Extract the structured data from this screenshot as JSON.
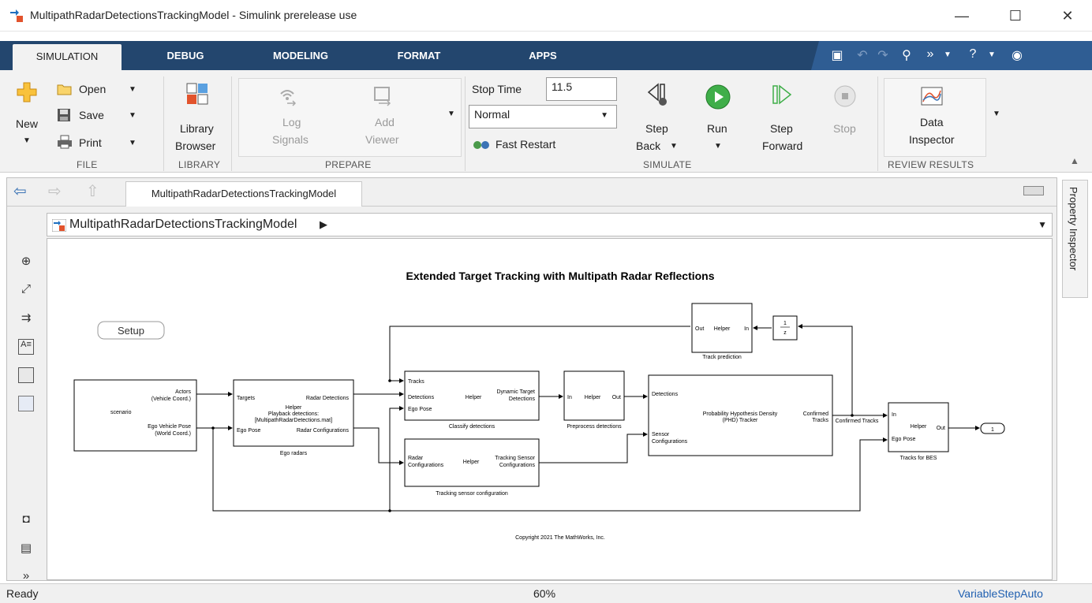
{
  "window": {
    "title": "MultipathRadarDetectionsTrackingModel - Simulink prerelease use",
    "minimize": "—",
    "maximize": "☐",
    "close": "✕"
  },
  "tabs": [
    {
      "label": "SIMULATION"
    },
    {
      "label": "DEBUG"
    },
    {
      "label": "MODELING"
    },
    {
      "label": "FORMAT"
    },
    {
      "label": "APPS"
    }
  ],
  "ribbon": {
    "file": {
      "new_label": "New",
      "open_label": "Open",
      "save_label": "Save",
      "print_label": "Print",
      "section": "FILE"
    },
    "library": {
      "browser_label_1": "Library",
      "browser_label_2": "Browser",
      "section": "LIBRARY"
    },
    "prepare": {
      "log_1": "Log",
      "log_2": "Signals",
      "add_1": "Add",
      "add_2": "Viewer",
      "section": "PREPARE"
    },
    "simulate": {
      "stop_time_label": "Stop Time",
      "stop_time_value": "11.5",
      "mode_value": "Normal",
      "fast_restart": "Fast Restart",
      "step_back_1": "Step",
      "step_back_2": "Back",
      "run": "Run",
      "step_fwd_1": "Step",
      "step_fwd_2": "Forward",
      "stop": "Stop",
      "section": "SIMULATE"
    },
    "review": {
      "data_1": "Data",
      "data_2": "Inspector",
      "section": "REVIEW RESULTS"
    }
  },
  "editor": {
    "model_tab": "MultipathRadarDetectionsTrackingModel",
    "breadcrumb": "MultipathRadarDetectionsTrackingModel"
  },
  "property_inspector": "Property Inspector",
  "diagram": {
    "title": "Extended Target Tracking with Multipath Radar Reflections",
    "setup": "Setup",
    "copyright": "Copyright 2021 The MathWorks, Inc.",
    "scenario": {
      "actors_1": "Actors",
      "actors_2": "(Vehicle Coord.)",
      "name": "scenario",
      "ego_1": "Ego Vehicle Pose",
      "ego_2": "(World Coord.)"
    },
    "ego_radars": {
      "targets": "Targets",
      "ego_pose": "Ego Pose",
      "radar_detections": "Radar Detections",
      "radar_configs": "Radar Configurations",
      "helper": "Helper",
      "playback_1": "Playback detections:",
      "playback_2": "[MultipathRadarDetections.mat]",
      "caption": "Ego radars"
    },
    "classify": {
      "tracks": "Tracks",
      "detections": "Detections",
      "ego_pose": "Ego Pose",
      "helper": "Helper",
      "out_1": "Dynamic Target",
      "out_2": "Detections",
      "caption": "Classify detections"
    },
    "tracking_config": {
      "in_1": "Radar",
      "in_2": "Configurations",
      "helper": "Helper",
      "out_1": "Tracking Sensor",
      "out_2": "Configurations",
      "caption": "Tracking sensor configuration"
    },
    "preprocess": {
      "in": "In",
      "helper": "Helper",
      "out": "Out",
      "caption": "Preprocess detections"
    },
    "phd": {
      "detections": "Detections",
      "sensor_1": "Sensor",
      "sensor_2": "Configurations",
      "name_1": "Probability Hypothesis Density",
      "name_2": "(PHD) Tracker",
      "out_1": "Confirmed",
      "out_2": "Tracks",
      "signal": "Confirmed Tracks"
    },
    "track_prediction": {
      "out": "Out",
      "helper": "Helper",
      "in": "In",
      "caption": "Track prediction"
    },
    "delay": {
      "num": "1",
      "den": "z"
    },
    "tracks_bes": {
      "in": "In",
      "helper": "Helper",
      "out": "Out",
      "ego_pose": "Ego Pose",
      "caption": "Tracks for BES"
    },
    "outport": "1"
  },
  "status": {
    "state": "Ready",
    "zoom": "60%",
    "solver": "VariableStepAuto"
  }
}
